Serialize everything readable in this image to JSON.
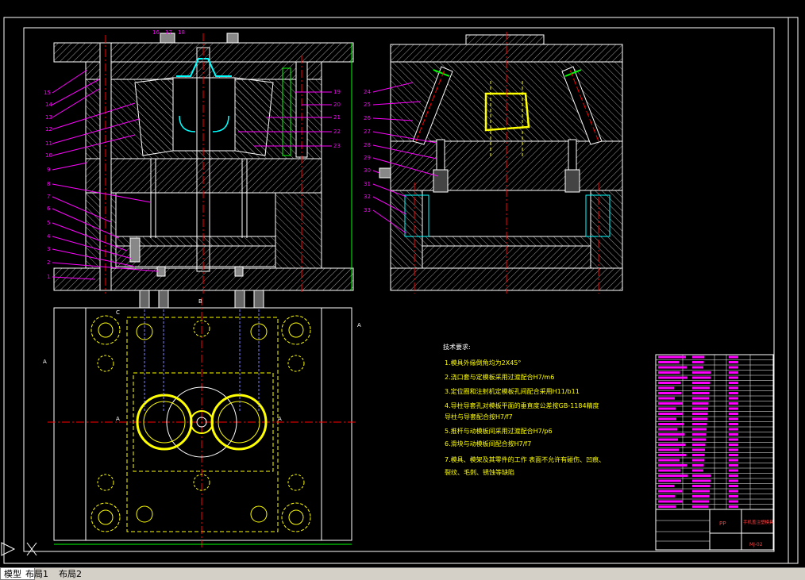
{
  "tabs": [
    {
      "label": "模型",
      "active": true
    },
    {
      "label": "布局1",
      "active": false
    },
    {
      "label": "布局2",
      "active": false
    }
  ],
  "tech_requirements": {
    "heading": "技术要求:",
    "items": [
      "1.模具外缘倒角均为2X45°",
      "2.浇口套与定模板采用过渡配合H7/m6",
      "3.定位圈和注射机定模板孔间配合采用H11/b11",
      "4.导柱导套孔对模板平面的垂直度公差按GB-1184精度",
      "  导柱与导套配合按H7/f7",
      "5.推杆与动模板间采用过渡配合H7/p6",
      "6.滑块与动模板间配合按H7/f7",
      "7.模具、模架及其零件的工作 表面不允许有碰伤、凹痕、",
      "裂纹、毛刺、锈蚀等缺陷"
    ]
  },
  "title_block": {
    "material": "PP",
    "drawing_name": "手机盖注塑模具",
    "drawing_number": "MJ-02"
  },
  "callouts_left": [
    "15",
    "14",
    "13",
    "12",
    "11",
    "10",
    "9",
    "8",
    "7",
    "6",
    "5",
    "4",
    "3",
    "2",
    "1"
  ],
  "callouts_left_right": [
    "19",
    "20",
    "21",
    "22",
    "23"
  ],
  "callouts_top": [
    "16",
    "17",
    "18"
  ],
  "callouts_mid": [
    "24",
    "25",
    "26",
    "27",
    "28",
    "29",
    "30",
    "31",
    "32",
    "33"
  ],
  "section_labels": {
    "a": "A",
    "b": "B",
    "c": "C"
  },
  "colors": {
    "background": "#000000",
    "frame": "#ffffff",
    "callout": "#ff00ff",
    "centerline": "#ff0000",
    "yellow": "#ffff00",
    "cyan": "#00ffff",
    "green": "#00ff00",
    "hatch": "#b0b0b0"
  }
}
